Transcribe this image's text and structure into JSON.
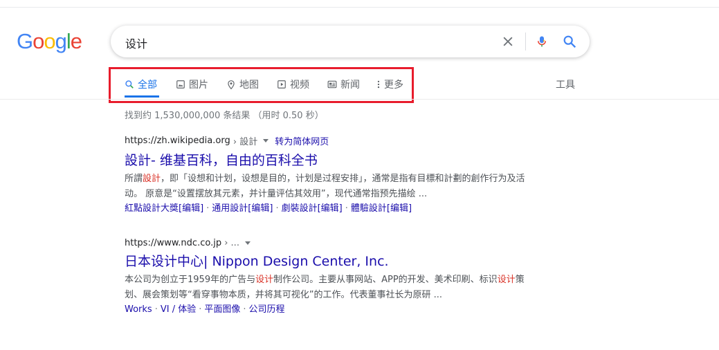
{
  "logo": {
    "letters": [
      "G",
      "o",
      "o",
      "g",
      "l",
      "e"
    ],
    "colors": [
      "#4285f4",
      "#ea4335",
      "#fbbc05",
      "#4285f4",
      "#34a853",
      "#ea4335"
    ]
  },
  "search": {
    "query": "设计",
    "clear_icon": "close-icon",
    "voice_icon": "microphone-icon",
    "submit_icon": "search-icon"
  },
  "tabs": [
    {
      "label": "全部",
      "icon": "search-icon",
      "active": true
    },
    {
      "label": "图片",
      "icon": "image-icon",
      "active": false
    },
    {
      "label": "地图",
      "icon": "map-pin-icon",
      "active": false
    },
    {
      "label": "视频",
      "icon": "video-icon",
      "active": false
    },
    {
      "label": "新闻",
      "icon": "news-icon",
      "active": false
    },
    {
      "label": "更多",
      "icon": "more-vert-icon",
      "active": false
    }
  ],
  "tools_label": "工具",
  "stats": "找到约 1,530,000,000 条结果 （用时 0.50 秒）",
  "colors": {
    "link": "#1a0dab",
    "accent": "#1a73e8",
    "highlight_box": "#e81c2c",
    "keyword": "#d93025"
  },
  "results": [
    {
      "url": "https://zh.wikipedia.org",
      "path": "› 設計",
      "translate": "转为简体网页",
      "title": "設計- 维基百科，自由的百科全书",
      "snippet_parts": [
        "所謂",
        "設計",
        "，即「设想和计划，设想是目的，计划是过程安排」，通常是指有目標和計劃的創作行为及活动。 原意是“设置摆放其元素，并计量评估其效用”，现代通常指预先描绘 ..."
      ],
      "sitelinks": [
        "紅點設計大獎[编辑]",
        "通用設計[编辑]",
        "劇裝設計[编辑]",
        "體驗設計[编辑]"
      ]
    },
    {
      "url": "https://www.ndc.co.jp",
      "path": "› ...",
      "title": "日本设计中心| Nippon Design Center, Inc.",
      "snippet_parts": [
        "本公司为创立于1959年的广告与",
        "设计",
        "制作公司。主要从事网站、APP的开发、美术印刷、标识",
        "设计",
        "策划、展会策划等“看穿事物本质，并将其可视化”的工作。代表董事社长为原研 ..."
      ],
      "sitelinks": [
        "Works",
        "VI / 体验",
        "平面图像",
        "公司历程"
      ]
    }
  ]
}
